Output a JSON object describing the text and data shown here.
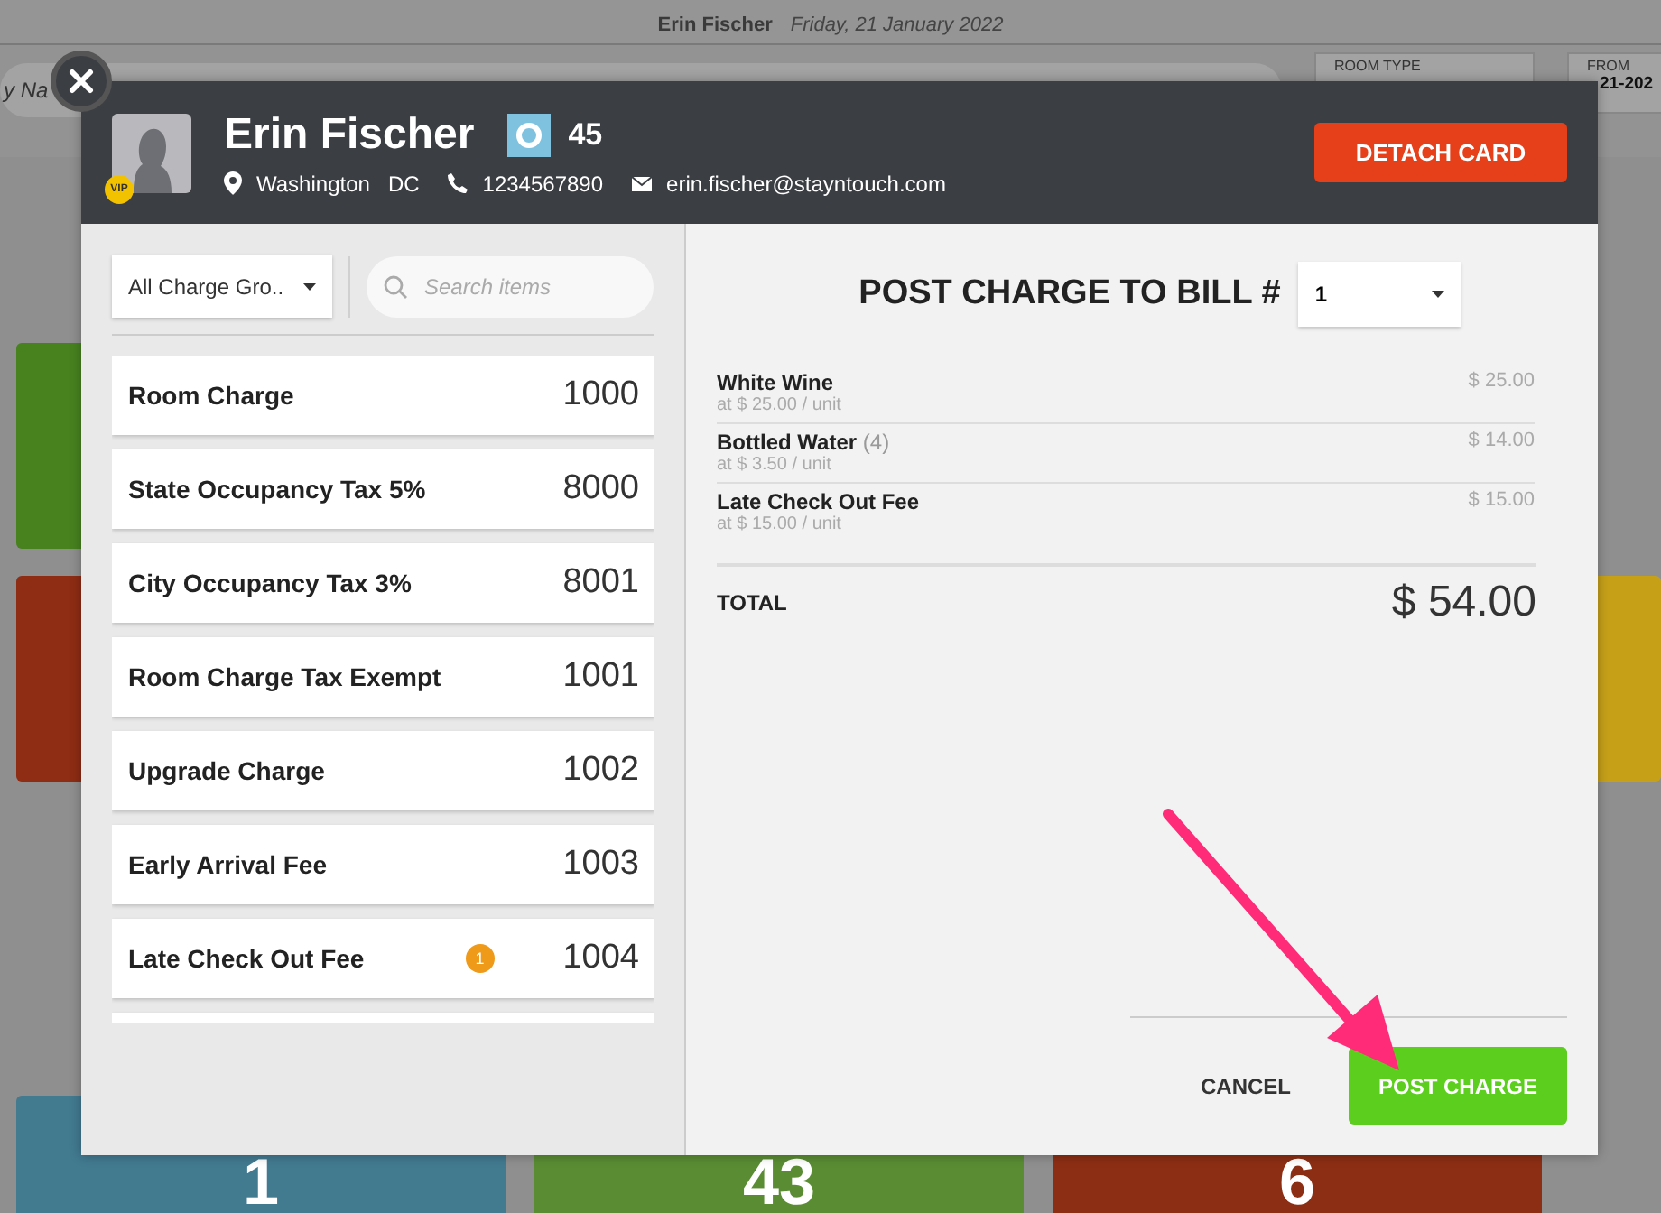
{
  "background": {
    "guest_name": "Erin Fischer",
    "date": "Friday, 21 January 2022",
    "search_placeholder": "y Na",
    "filters": [
      {
        "label": "ROOM TYPE"
      },
      {
        "label": "FROM",
        "value": "21-202"
      }
    ],
    "left_tiles": [
      {
        "color": "#47821f"
      },
      {
        "color": "#8e2c14"
      }
    ],
    "right_tiles": [
      {
        "color": "#c6a118"
      }
    ],
    "bottom_tiles": [
      {
        "count": "1",
        "color": "#427a90"
      },
      {
        "count": "43",
        "color": "#5a8c34"
      },
      {
        "count": "6",
        "color": "#8c2e14"
      }
    ]
  },
  "modal": {
    "guest": {
      "name": "Erin Fischer",
      "vip": "VIP",
      "room": "45",
      "city": "Washington",
      "state": "DC",
      "phone": "1234567890",
      "email": "erin.fischer@stayntouch.com"
    },
    "detach_button": "DETACH CARD",
    "charge_group": "All Charge Gro..",
    "search": {
      "placeholder": "Search items"
    },
    "items": [
      {
        "name": "Room Charge",
        "code": "1000"
      },
      {
        "name": "State Occupancy Tax 5%",
        "code": "8000"
      },
      {
        "name": "City Occupancy Tax 3%",
        "code": "8001"
      },
      {
        "name": "Room Charge Tax Exempt",
        "code": "1001"
      },
      {
        "name": "Upgrade Charge",
        "code": "1002"
      },
      {
        "name": "Early Arrival Fee",
        "code": "1003"
      },
      {
        "name": "Late Check Out Fee",
        "code": "1004",
        "badge": "1"
      }
    ],
    "bill_title": "POST CHARGE TO BILL #",
    "bill_number": "1",
    "lines": [
      {
        "name": "White Wine",
        "rate": "at $ 25.00 / unit",
        "amount": "$ 25.00"
      },
      {
        "name": "Bottled Water",
        "quantity": "(4)",
        "rate": "at $ 3.50 / unit",
        "amount": "$ 14.00"
      },
      {
        "name": "Late Check Out Fee",
        "rate": "at $ 15.00 / unit",
        "amount": "$ 15.00"
      }
    ],
    "total_label": "TOTAL",
    "total": "$ 54.00",
    "cancel_button": "CANCEL",
    "post_button": "POST CHARGE"
  }
}
